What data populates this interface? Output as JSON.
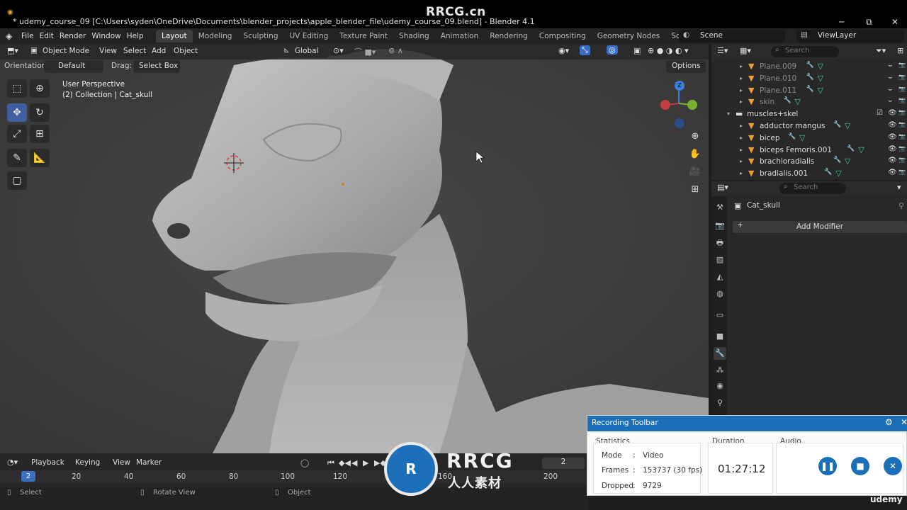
{
  "window": {
    "title": "* udemy_course_09 [C:\\Users\\syden\\OneDrive\\Documents\\blender_projects\\apple_blender_file\\udemy_course_09.blend] - Blender 4.1",
    "watermark": "RRCG.cn",
    "minimize": "─",
    "maximize": "⧉",
    "close": "✕"
  },
  "menu": [
    "File",
    "Edit",
    "Render",
    "Window",
    "Help"
  ],
  "workspaces": [
    "Layout",
    "Modeling",
    "Sculpting",
    "UV Editing",
    "Texture Paint",
    "Shading",
    "Animation",
    "Rendering",
    "Compositing",
    "Geometry Nodes",
    "Scripting",
    "+"
  ],
  "active_workspace": "Layout",
  "scene": "Scene",
  "view_layer": "ViewLayer",
  "viewport": {
    "mode": "Object Mode",
    "menus": [
      "View",
      "Select",
      "Add",
      "Object"
    ],
    "transform": "Global",
    "orientation_label": "Orientation:",
    "orientation_value": "Default",
    "drag_label": "Drag:",
    "drag_value": "Select Box",
    "options": "Options",
    "perspective": "User Perspective",
    "collection": "(2) Collection | Cat_skull"
  },
  "outliner": {
    "search_placeholder": "Search",
    "rows": [
      {
        "name": "Plane.009",
        "dim": true
      },
      {
        "name": "Plane.010",
        "dim": true
      },
      {
        "name": "Plane.011",
        "dim": true
      },
      {
        "name": "skin",
        "dim": true
      },
      {
        "name": "muscles+skel",
        "collection": true
      },
      {
        "name": "adductor mangus"
      },
      {
        "name": "bicep"
      },
      {
        "name": "biceps Femoris.001"
      },
      {
        "name": "brachioradialis"
      },
      {
        "name": "bradialis.001"
      }
    ]
  },
  "properties": {
    "search_placeholder": "Search",
    "object_name": "Cat_skull",
    "add_modifier": "Add Modifier"
  },
  "timeline": {
    "menus": [
      "Playback",
      "Keying",
      "View",
      "Marker"
    ],
    "current_frame": "2",
    "frame_field": "2",
    "ticks": [
      "20",
      "40",
      "60",
      "80",
      "100",
      "120",
      "160",
      "200"
    ]
  },
  "status": [
    "Select",
    "Rotate View",
    "Object"
  ],
  "recording": {
    "title": "Recording Toolbar",
    "statistics_label": "Statistics",
    "mode_label": "Mode",
    "mode_value": "Video",
    "frames_label": "Frames",
    "frames_value": "153737 (30 fps)",
    "dropped_label": "Dropped",
    "dropped_value": "9729",
    "duration_label": "Duration",
    "duration_value": "01:27:12",
    "audio_label": "Audio"
  },
  "brand": {
    "logo_text": "RRCG",
    "logo_sub": "人人素材",
    "udemy": "udemy"
  },
  "colors": {
    "accent": "#3b6fc4",
    "recording_blue": "#1a6fb8",
    "object_orange": "#f09c38",
    "mesh_green": "#3ec8a0"
  }
}
